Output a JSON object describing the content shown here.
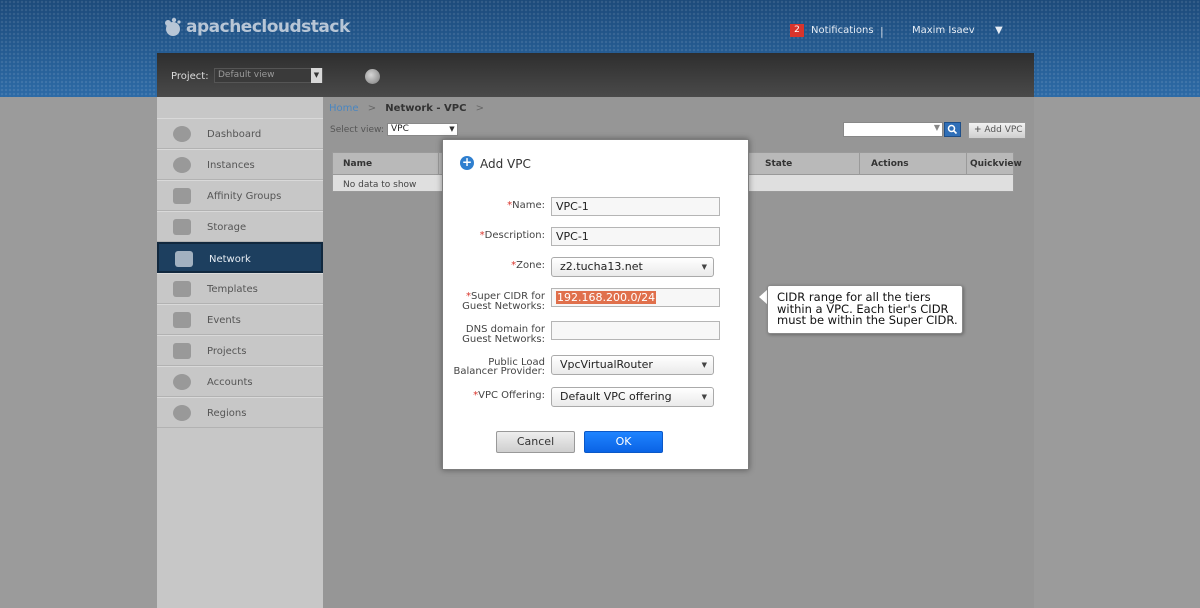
{
  "header": {
    "logo_text": "apachecloudstack",
    "notifications_count": "2",
    "notifications_label": "Notifications",
    "separator": "|",
    "user_name": "Maxim Isaev",
    "user_caret": "▼"
  },
  "project_bar": {
    "label": "Project:",
    "selected": "Default view",
    "arrow": "▼"
  },
  "sidebar": {
    "items": [
      {
        "label": "Dashboard",
        "icon": "dashboard-icon"
      },
      {
        "label": "Instances",
        "icon": "cloud-icon"
      },
      {
        "label": "Affinity Groups",
        "icon": "affinity-icon"
      },
      {
        "label": "Storage",
        "icon": "storage-icon"
      },
      {
        "label": "Network",
        "icon": "network-icon"
      },
      {
        "label": "Templates",
        "icon": "templates-icon"
      },
      {
        "label": "Events",
        "icon": "calendar-icon"
      },
      {
        "label": "Projects",
        "icon": "folder-icon"
      },
      {
        "label": "Accounts",
        "icon": "user-icon"
      },
      {
        "label": "Regions",
        "icon": "globe-icon"
      }
    ],
    "active_index": 4
  },
  "main": {
    "breadcrumb": {
      "home": "Home",
      "sep": ">",
      "current": "Network - VPC",
      "trailing": ">"
    },
    "select_view_label": "Select view:",
    "select_view_value": "VPC",
    "select_arrow": "▼",
    "add_vpc_label": "Add VPC",
    "table": {
      "columns": [
        "Name",
        "State",
        "Actions",
        "Quickview"
      ],
      "empty_text": "No data to show"
    }
  },
  "dialog": {
    "title": "Add VPC",
    "required_mark": "*",
    "fields": {
      "name_label": "Name:",
      "name_value": "VPC-1",
      "description_label": "Description:",
      "description_value": "VPC-1",
      "zone_label": "Zone:",
      "zone_value": "z2.tucha13.net",
      "cidr_label_1": "Super CIDR for",
      "cidr_label_2": "Guest Networks:",
      "cidr_value": "192.168.200.0/24",
      "dns_label_1": "DNS domain for",
      "dns_label_2": "Guest Networks:",
      "dns_value": "",
      "lb_label_1": "Public Load",
      "lb_label_2": "Balancer Provider:",
      "lb_value": "VpcVirtualRouter",
      "offering_label": "VPC Offering:",
      "offering_value": "Default VPC offering"
    },
    "cancel_label": "Cancel",
    "ok_label": "OK"
  },
  "tooltip": {
    "line1": "CIDR range for all the tiers",
    "line2": "within a VPC. Each tier's CIDR",
    "line3": "must be within the Super CIDR."
  },
  "colors": {
    "header_top": "#1c4a7a",
    "active_nav": "#1d3f5f",
    "ok_button": "#1f84ff",
    "required": "#d9342b"
  }
}
